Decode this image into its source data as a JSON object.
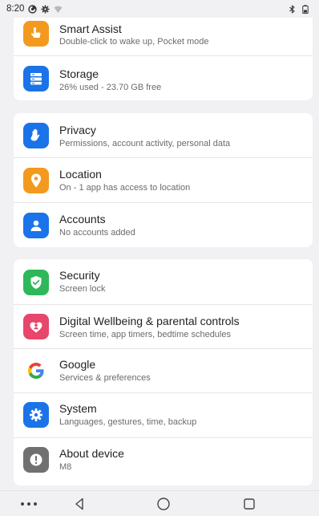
{
  "status_bar": {
    "time": "8:20"
  },
  "settings": {
    "group1": [
      {
        "title": "Smart Assist",
        "subtitle": "Double-click to wake up, Pocket mode",
        "icon": "hand-pointer-icon",
        "color": "#f39a1e"
      },
      {
        "title": "Storage",
        "subtitle": "26% used - 23.70 GB free",
        "icon": "storage-icon",
        "color": "#1a73e8"
      }
    ],
    "group2": [
      {
        "title": "Privacy",
        "subtitle": "Permissions, account activity, personal data",
        "icon": "hand-icon",
        "color": "#1a73e8"
      },
      {
        "title": "Location",
        "subtitle": "On - 1 app has access to location",
        "icon": "location-pin-icon",
        "color": "#f39a1e"
      },
      {
        "title": "Accounts",
        "subtitle": "No accounts added",
        "icon": "account-icon",
        "color": "#1a73e8"
      }
    ],
    "group3": [
      {
        "title": "Security",
        "subtitle": "Screen lock",
        "icon": "shield-check-icon",
        "color": "#2fb85a"
      },
      {
        "title": "Digital Wellbeing & parental controls",
        "subtitle": "Screen time, app timers, bedtime schedules",
        "icon": "heart-person-icon",
        "color": "#e8466a"
      },
      {
        "title": "Google",
        "subtitle": "Services & preferences",
        "icon": "google-g-icon",
        "color": "#ffffff"
      },
      {
        "title": "System",
        "subtitle": "Languages, gestures, time, backup",
        "icon": "gear-icon",
        "color": "#1a73e8"
      },
      {
        "title": "About device",
        "subtitle": "M8",
        "icon": "info-icon",
        "color": "#707070"
      }
    ]
  }
}
